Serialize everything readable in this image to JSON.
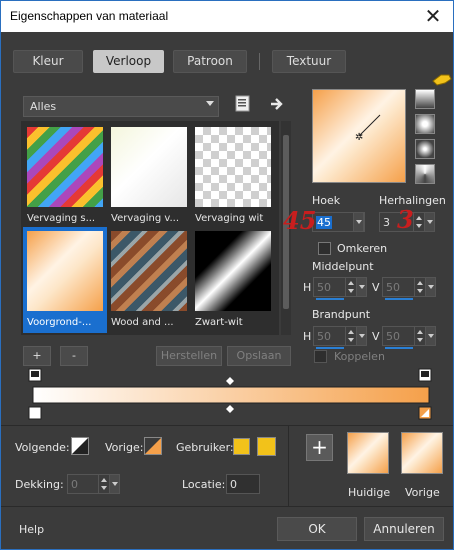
{
  "window": {
    "title": "Eigenschappen van materiaal",
    "close_glyph": "✕"
  },
  "tabs": [
    {
      "label": "Kleur"
    },
    {
      "label": "Verloop"
    },
    {
      "label": "Patroon"
    },
    {
      "label": "Textuur"
    }
  ],
  "category": {
    "value": "Alles"
  },
  "gradients": [
    {
      "caption": "Vervaging s..."
    },
    {
      "caption": "Vervaging v..."
    },
    {
      "caption": "Vervaging wit"
    },
    {
      "caption": "Voorgrond-..."
    },
    {
      "caption": "Wood and ..."
    },
    {
      "caption": "Zwart-wit"
    }
  ],
  "library_buttons": {
    "add": "+",
    "remove": "-",
    "reset": "Herstellen",
    "save": "Opslaan"
  },
  "angle": {
    "label": "Hoek",
    "value": "45"
  },
  "repeats": {
    "label": "Herhalingen",
    "value": "3"
  },
  "invert": {
    "label": "Omkeren"
  },
  "center": {
    "label": "Middelpunt",
    "h_label": "H",
    "h_value": "50",
    "v_label": "V",
    "v_value": "50"
  },
  "focal": {
    "label": "Brandpunt",
    "h_label": "H",
    "h_value": "50",
    "v_label": "V",
    "v_value": "50"
  },
  "link": {
    "label": "Koppelen"
  },
  "annotations": {
    "angle_hint": "45",
    "repeats_hint": "3"
  },
  "stops": {
    "next_label": "Volgende:",
    "prev_label": "Vorige:",
    "user_label": "Gebruiker:",
    "opacity_label": "Dekking:",
    "opacity_value": "0",
    "location_label": "Locatie:",
    "location_value": "0"
  },
  "swatches": {
    "current_label": "Huidige",
    "previous_label": "Vorige"
  },
  "footer": {
    "help": "Help",
    "ok": "OK",
    "cancel": "Annuleren"
  },
  "colors": {
    "accent": "#1a6fcf",
    "gradient_start": "#ffffff",
    "gradient_end": "#f5a04a",
    "user_swatch": "#f2c21a"
  }
}
